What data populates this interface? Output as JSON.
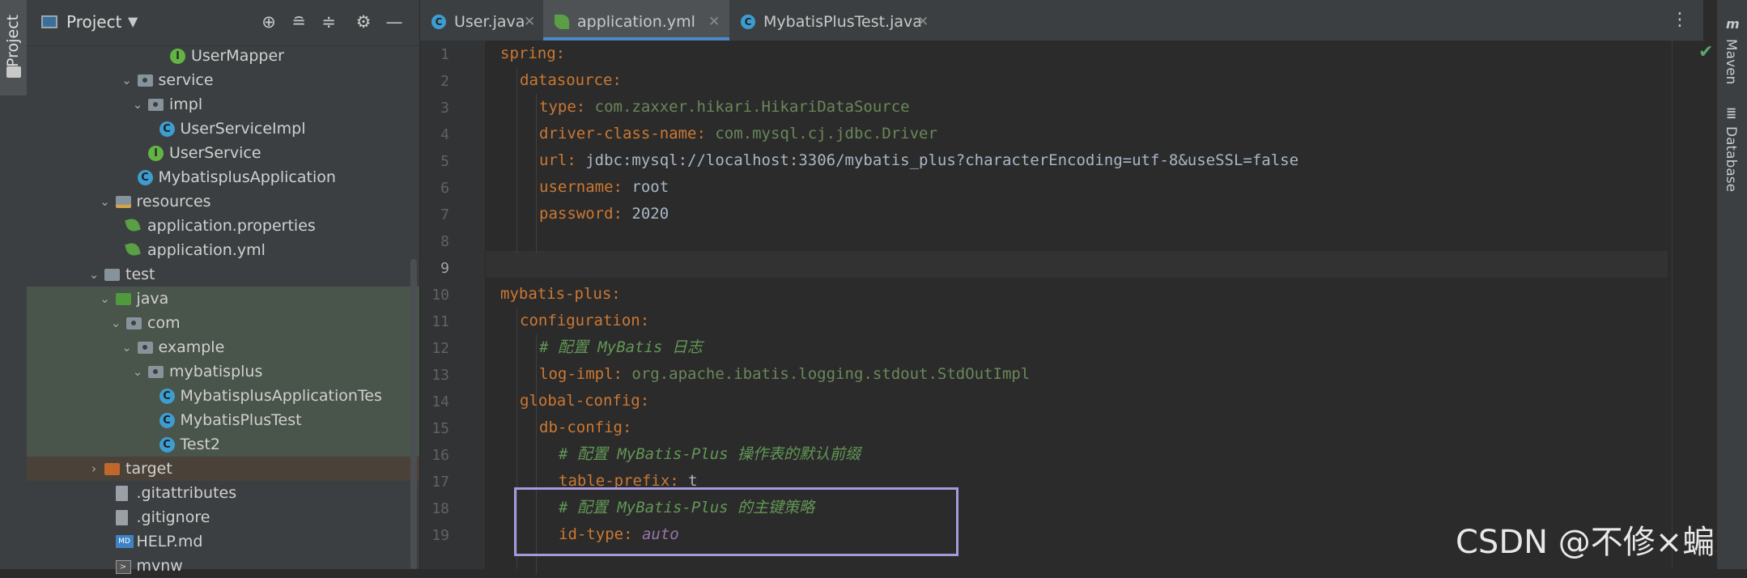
{
  "left_stripe": {
    "project_tab": "Project"
  },
  "project_panel": {
    "title": "Project",
    "tree": [
      {
        "label": "UserMapper",
        "icon": "interface-icon"
      },
      {
        "label": "service",
        "icon": "package-folder-icon"
      },
      {
        "label": "impl",
        "icon": "package-folder-icon"
      },
      {
        "label": "UserServiceImpl",
        "icon": "class-icon"
      },
      {
        "label": "UserService",
        "icon": "interface-icon"
      },
      {
        "label": "MybatisplusApplication",
        "icon": "springboot-class-icon"
      },
      {
        "label": "resources",
        "icon": "resources-folder-icon"
      },
      {
        "label": "application.properties",
        "icon": "spring-config-icon"
      },
      {
        "label": "application.yml",
        "icon": "spring-config-icon"
      },
      {
        "label": "test",
        "icon": "folder-icon"
      },
      {
        "label": "java",
        "icon": "test-source-folder-icon"
      },
      {
        "label": "com",
        "icon": "package-folder-icon"
      },
      {
        "label": "example",
        "icon": "package-folder-icon"
      },
      {
        "label": "mybatisplus",
        "icon": "package-folder-icon"
      },
      {
        "label": "MybatisplusApplicationTes",
        "icon": "springboot-class-icon"
      },
      {
        "label": "MybatisPlusTest",
        "icon": "springboot-class-icon"
      },
      {
        "label": "Test2",
        "icon": "springboot-class-icon"
      },
      {
        "label": "target",
        "icon": "excluded-folder-icon"
      },
      {
        "label": ".gitattributes",
        "icon": "file-icon"
      },
      {
        "label": ".gitignore",
        "icon": "file-icon"
      },
      {
        "label": "HELP.md",
        "icon": "markdown-icon"
      },
      {
        "label": "mvnw",
        "icon": "terminal-file-icon"
      }
    ]
  },
  "tabs": [
    {
      "label": "User.java",
      "icon": "class-icon"
    },
    {
      "label": "application.yml",
      "icon": "spring-config-icon",
      "active": true
    },
    {
      "label": "MybatisPlusTest.java",
      "icon": "springboot-class-icon"
    }
  ],
  "editor": {
    "line_numbers": [
      "1",
      "2",
      "3",
      "4",
      "5",
      "6",
      "7",
      "8",
      "9",
      "10",
      "11",
      "12",
      "13",
      "14",
      "15",
      "16",
      "17",
      "18",
      "19"
    ],
    "current_line": "9",
    "lines": [
      {
        "key": "spring",
        "sep": ":",
        "val": ""
      },
      {
        "key": "datasource",
        "sep": ":",
        "val": ""
      },
      {
        "key": "type",
        "sep": ": ",
        "val": "com.zaxxer.hikari.HikariDataSource"
      },
      {
        "key": "driver-class-name",
        "sep": ": ",
        "val": "com.mysql.cj.jdbc.Driver"
      },
      {
        "key": "url",
        "sep": ": ",
        "val": "jdbc:mysql://localhost:3306/mybatis_plus?characterEncoding=utf-8&useSSL=false"
      },
      {
        "key": "username",
        "sep": ": ",
        "val": "root"
      },
      {
        "key": "password",
        "sep": ": ",
        "val": "2020"
      },
      {
        "key": "",
        "sep": "",
        "val": ""
      },
      {
        "key": "",
        "sep": "",
        "val": ""
      },
      {
        "key": "mybatis-plus",
        "sep": ":",
        "val": ""
      },
      {
        "key": "configuration",
        "sep": ":",
        "val": ""
      },
      {
        "comment": "# 配置 MyBatis 日志"
      },
      {
        "key": "log-impl",
        "sep": ": ",
        "val": "org.apache.ibatis.logging.stdout.StdOutImpl"
      },
      {
        "key": "global-config",
        "sep": ":",
        "val": ""
      },
      {
        "key": "db-config",
        "sep": ":",
        "val": ""
      },
      {
        "comment": "# 配置 MyBatis-Plus 操作表的默认前缀"
      },
      {
        "key": "table-prefix",
        "sep": ": ",
        "val": "t_"
      },
      {
        "comment": "# 配置 MyBatis-Plus 的主键策略"
      },
      {
        "key": "id-type",
        "sep": ": ",
        "val": "auto"
      }
    ]
  },
  "right_stripe": {
    "maven_tab": "Maven",
    "database_tab": "Database"
  },
  "watermark": "CSDN @不修×蝙蝠",
  "colors": {
    "accent": "#4a88c7",
    "highlight_box": "#a799dd",
    "yaml_key": "#cc7832",
    "comment": "#629755"
  }
}
